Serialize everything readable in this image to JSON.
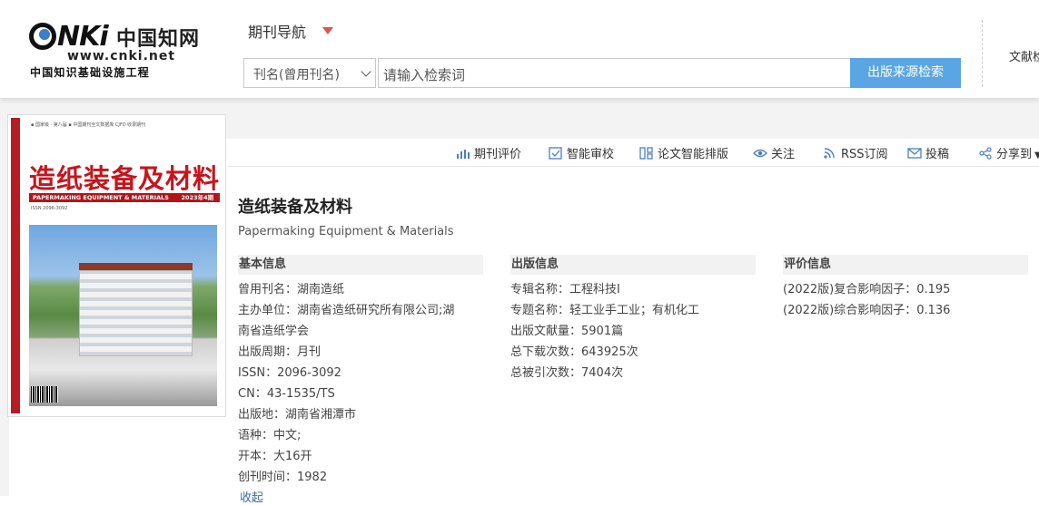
{
  "header": {
    "logo": {
      "mark": "NKi",
      "chinese": "中国知网",
      "url": "www.cnki.net",
      "tagline": "中国知识基础设施工程"
    },
    "nav_title": "期刊导航",
    "search": {
      "select_value": "刊名(曾用刊名)",
      "placeholder": "请输入检索词",
      "button": "出版来源检索"
    },
    "right_link": "文献检"
  },
  "cover": {
    "title": "造纸装备及材料",
    "band": "PAPERMAKING EQUIPMENT & MATERIALS",
    "issue": "2023年4期",
    "issn": "ISSN 2096-3092"
  },
  "toolbar": [
    {
      "label": "期刊评价",
      "icon": "chart-icon"
    },
    {
      "label": "智能审校",
      "icon": "proofread-icon"
    },
    {
      "label": "论文智能排版",
      "icon": "layout-icon"
    },
    {
      "label": "关注",
      "icon": "eye-icon"
    },
    {
      "label": "RSS订阅",
      "icon": "rss-icon"
    },
    {
      "label": "投稿",
      "icon": "mail-icon"
    },
    {
      "label": "分享到",
      "icon": "share-icon"
    }
  ],
  "journal": {
    "title": "造纸装备及材料",
    "english": "Papermaking Equipment & Materials"
  },
  "sections": {
    "basic": {
      "title": "基本信息",
      "rows": [
        {
          "k": "曾用刊名：",
          "v": "湖南造纸"
        },
        {
          "k": "主办单位：",
          "v": "湖南省造纸研究所有限公司;湖南省造纸学会"
        },
        {
          "k": "出版周期：",
          "v": "月刊"
        },
        {
          "k": "ISSN：",
          "v": "2096-3092"
        },
        {
          "k": "CN：",
          "v": "43-1535/TS"
        },
        {
          "k": "出版地：",
          "v": "湖南省湘潭市"
        },
        {
          "k": "语种：",
          "v": "中文;"
        },
        {
          "k": "开本：",
          "v": "大16开"
        },
        {
          "k": "创刊时间：",
          "v": "1982"
        }
      ],
      "more": "收起"
    },
    "publish": {
      "title": "出版信息",
      "rows": [
        {
          "k": "专辑名称：",
          "v": "工程科技I"
        },
        {
          "k": "专题名称：",
          "v": "轻工业手工业；有机化工"
        },
        {
          "k": "出版文献量：",
          "v": "5901篇"
        },
        {
          "k": "总下载次数：",
          "v": "643925次"
        },
        {
          "k": "总被引次数：",
          "v": "7404次"
        }
      ]
    },
    "eval": {
      "title": "评价信息",
      "rows": [
        {
          "k": "(2022版)复合影响因子：",
          "v": "0.195"
        },
        {
          "k": "(2022版)综合影响因子：",
          "v": "0.136"
        }
      ]
    }
  }
}
